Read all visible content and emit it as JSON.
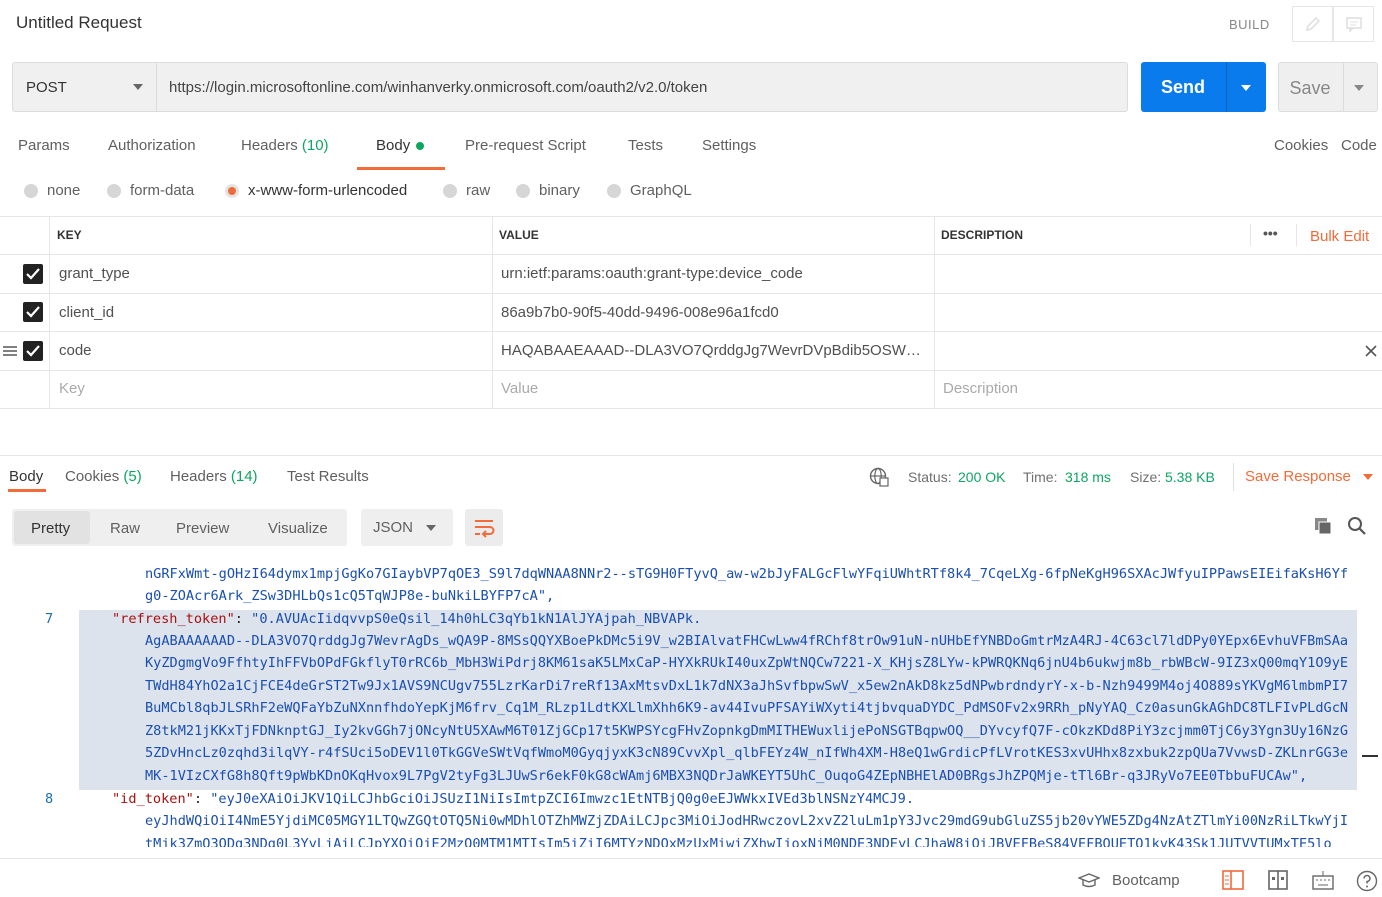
{
  "title": "Untitled Request",
  "build_label": "BUILD",
  "request": {
    "method": "POST",
    "url": "https://login.microsoftonline.com/winhanverky.onmicrosoft.com/oauth2/v2.0/token",
    "send_label": "Send",
    "save_label": "Save"
  },
  "tabs": {
    "params": "Params",
    "authorization": "Authorization",
    "headers": "Headers",
    "headers_count": "(10)",
    "body": "Body",
    "prerequest": "Pre-request Script",
    "tests": "Tests",
    "settings": "Settings",
    "cookies": "Cookies",
    "code": "Code"
  },
  "body_types": {
    "none": "none",
    "form_data": "form-data",
    "urlencoded": "x-www-form-urlencoded",
    "raw": "raw",
    "binary": "binary",
    "graphql": "GraphQL",
    "selected": "x-www-form-urlencoded"
  },
  "params_table": {
    "headers": {
      "key": "KEY",
      "value": "VALUE",
      "description": "DESCRIPTION",
      "more": "•••",
      "bulk_edit": "Bulk Edit"
    },
    "rows": [
      {
        "key": "grant_type",
        "value": "urn:ietf:params:oauth:grant-type:device_code",
        "checked": true
      },
      {
        "key": "client_id",
        "value": "86a9b7b0-90f5-40dd-9496-008e96a1fcd0",
        "checked": true
      },
      {
        "key": "code",
        "value": "HAQABAAEAAAD--DLA3VO7QrddgJg7WevrDVpBdib5OSWJx…",
        "checked": true
      }
    ],
    "placeholders": {
      "key": "Key",
      "value": "Value",
      "description": "Description"
    }
  },
  "response": {
    "tabs": {
      "body": "Body",
      "cookies": "Cookies",
      "cookies_count": "(5)",
      "headers": "Headers",
      "headers_count": "(14)",
      "test_results": "Test Results"
    },
    "status_label": "Status:",
    "status": "200 OK",
    "time_label": "Time:",
    "time": "318 ms",
    "size_label": "Size:",
    "size": "5.38 KB",
    "save_response": "Save Response",
    "views": {
      "pretty": "Pretty",
      "raw": "Raw",
      "preview": "Preview",
      "visualize": "Visualize",
      "format": "JSON"
    }
  },
  "code": {
    "lines": [
      {
        "num": "",
        "text": "nGRFxWmt-gOHzI64dymx1mpjGgKo7GIaybVP7qOE3_S9l7dqWNAA8NNr2--sTG9H0FTyvQ_aw-w2bJyFALGcFlwYFqiUWhtRTf8k4_7CqeLXg-6fpNeKgH96SXAcJWfyuIPPawsEIEifaKsH6Yf"
      },
      {
        "num": "",
        "text": "g0-ZOAcr6Ark_ZSw3DHLbQs1cQ5TqWJP8e-buNkiLBYFP7cA\","
      },
      {
        "num": "7",
        "key": "\"refresh_token\"",
        "val": "\"0.AVUAcIidqvvpS0eQsil_14h0hLC3qYb1kN1AlJYAjpah_NBVAPk."
      },
      {
        "num": "",
        "text": "AgABAAAAAAD--DLA3VO7QrddgJg7WevrAgDs_wQA9P-8MSsQQYXBoePkDMc5i9V_w2BIAlvatFHCwLww4fRChf8trOw91uN-nUHbEfYNBDoGmtrMzA4RJ-4C63cl7ldDPy0YEpx6EvhuVFBmSAa"
      },
      {
        "num": "",
        "text": "KyZDgmgVo9FfhtyIhFFVbOPdFGkflyT0rRC6b_MbH3WiPdrj8KM61saK5LMxCaP-HYXkRUkI40uxZpWtNQCw7221-X_KHjsZ8LYw-kPWRQKNq6jnU4b6ukwjm8b_rbWBcW-9IZ3xQ00mqY1O9yE"
      },
      {
        "num": "",
        "text": "TWdH84YhO2a1CjFCE4deGrST2Tw9Jx1AVS9NCUgv755LzrKarDi7reRf13AxMtsvDxL1k7dNX3aJhSvfbpwSwV_x5ew2nAkD8kz5dNPwbrdndyrY-x-b-Nzh9499M4oj4O889sYKVgM6lmbmPI7"
      },
      {
        "num": "",
        "text": "BuMCbl8qbJLSRhF2eWQFaYbZuNXnnfhdoYepKjM6frv_Cq1M_RLzp1LdtKXLlmXhh6K9-av44IvuPFSAYiWXyti4tjbvquaDYDC_PdMSOFv2x9RRh_pNyYAQ_Cz0asunGkAGhDC8TLFIvPLdGcN"
      },
      {
        "num": "",
        "text": "Z8tkM21jKKxTjFDNknptGJ_Iy2kvGGh7jONcyNtU5XAwM6T01ZjGCp17t5KWPSYcgFHvZopnkgDmMITHEWuxlijePoNSGTBqpwOQ__DYvcyfQ7F-cOkzKDd8PiY3zcjmm0TjC6y3Ygn3Uy16NzG"
      },
      {
        "num": "",
        "text": "5ZDvHncLz0zqhd3ilqVY-r4fSUci5oDEV1l0TkGGVeSWtVqfWmoM0GyqjyxK3cN89CvvXpl_qlbFEYz4W_nIfWh4XM-H8eQ1wGrdicPfLVrotKES3xvUHhx8zxbuk2zpQUa7VvwsD-ZKLnrGG3e"
      },
      {
        "num": "",
        "text": "MK-1VIzCXfG8h8Qft9pWbKDnOKqHvox9L7PgV2tyFg3LJUwSr6ekF0kG8cWAmj6MBX3NQDrJaWKEYT5UhC_OuqoG4ZEpNBHElAD0BRgsJhZPQMje-tTl6Br-q3JRyVo7EE0TbbuFUCAw\","
      },
      {
        "num": "8",
        "key": "\"id_token\"",
        "val": "\"eyJ0eXAiOiJKV1QiLCJhbGciOiJSUzI1NiIsImtpZCI6Imwzc1EtNTBjQ0g0eEJWWkxIVEd3blNSNzY4MCJ9."
      },
      {
        "num": "",
        "text": "eyJhdWQiOiI4NmE5YjdiMC05MGY1LTQwZGQtOTQ5Ni0wMDhlOTZhMWZjZDAiLCJpc3MiOiJodHRwczovL2xvZ2luLm1pY3Jvc29mdG9ubGluZS5jb20vYWE5ZDg4NzAtZTlmYi00NzRiLTkwYjI"
      },
      {
        "num": "",
        "text": "tMjk3ZmQ3ODg3NDg0L3YyLjAiLCJpYXQiOjE2MzQ0MTM1MTIsIm5iZiI6MTYzNDQxMzUxMiwiZXhwIjoxNjM0NDE3NDEyLCJhaW8iOiJBVEFBeS84VEFBQUETQ1kvK43Sk1JUTVVTUMxTE5lo"
      }
    ]
  },
  "footer": {
    "bootcamp": "Bootcamp"
  }
}
